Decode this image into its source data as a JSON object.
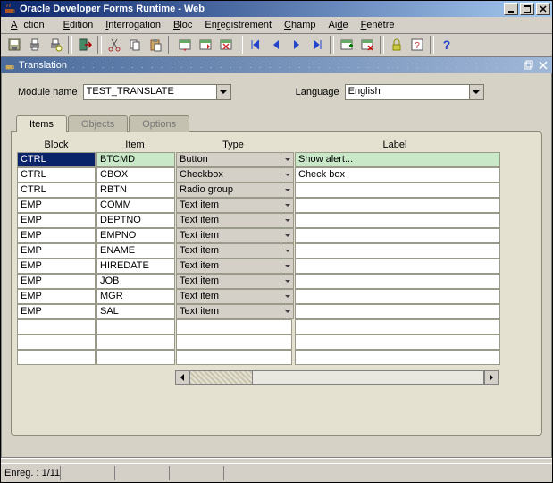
{
  "window": {
    "title": "Oracle Developer Forms Runtime - Web",
    "min": "_",
    "max": "□",
    "close": "×"
  },
  "menu": {
    "items": [
      "Action",
      "Edition",
      "Interrogation",
      "Bloc",
      "Enregistrement",
      "Champ",
      "Aide",
      "Fenêtre"
    ]
  },
  "toolbar_icons": [
    "save-icon",
    "print-icon",
    "print-setup-icon",
    "sep",
    "exit-icon",
    "sep",
    "cut-icon",
    "copy-icon",
    "paste-icon",
    "sep",
    "query-enter-icon",
    "query-exec-icon",
    "query-cancel-icon",
    "sep",
    "first-icon",
    "prev-icon",
    "next-icon",
    "last-icon",
    "sep",
    "insert-icon",
    "remove-icon",
    "sep",
    "lock-icon",
    "help-icon",
    "sep",
    "question-icon"
  ],
  "inner": {
    "title": "Translation",
    "restore": "◱",
    "close": "×"
  },
  "form": {
    "module_label": "Module name",
    "module_value": "TEST_TRANSLATE",
    "language_label": "Language",
    "language_value": "English"
  },
  "tabs": {
    "items": [
      "Items",
      "Objects",
      "Options"
    ],
    "active": 0
  },
  "grid": {
    "headers": {
      "block": "Block",
      "item": "Item",
      "type": "Type",
      "label": "Label"
    },
    "rows": [
      {
        "block": "CTRL",
        "item": "BTCMD",
        "type": "Button",
        "label": "Show alert...",
        "selected": true
      },
      {
        "block": "CTRL",
        "item": "CBOX",
        "type": "Checkbox",
        "label": "Check box"
      },
      {
        "block": "CTRL",
        "item": "RBTN",
        "type": "Radio group",
        "label": ""
      },
      {
        "block": "EMP",
        "item": "COMM",
        "type": "Text item",
        "label": ""
      },
      {
        "block": "EMP",
        "item": "DEPTNO",
        "type": "Text item",
        "label": ""
      },
      {
        "block": "EMP",
        "item": "EMPNO",
        "type": "Text item",
        "label": ""
      },
      {
        "block": "EMP",
        "item": "ENAME",
        "type": "Text item",
        "label": ""
      },
      {
        "block": "EMP",
        "item": "HIREDATE",
        "type": "Text item",
        "label": ""
      },
      {
        "block": "EMP",
        "item": "JOB",
        "type": "Text item",
        "label": ""
      },
      {
        "block": "EMP",
        "item": "MGR",
        "type": "Text item",
        "label": ""
      },
      {
        "block": "EMP",
        "item": "SAL",
        "type": "Text item",
        "label": ""
      },
      {
        "block": "",
        "item": "",
        "type": "",
        "label": ""
      },
      {
        "block": "",
        "item": "",
        "type": "",
        "label": ""
      },
      {
        "block": "",
        "item": "",
        "type": "",
        "label": ""
      }
    ]
  },
  "status": {
    "record": "Enreg. : 1/11"
  }
}
